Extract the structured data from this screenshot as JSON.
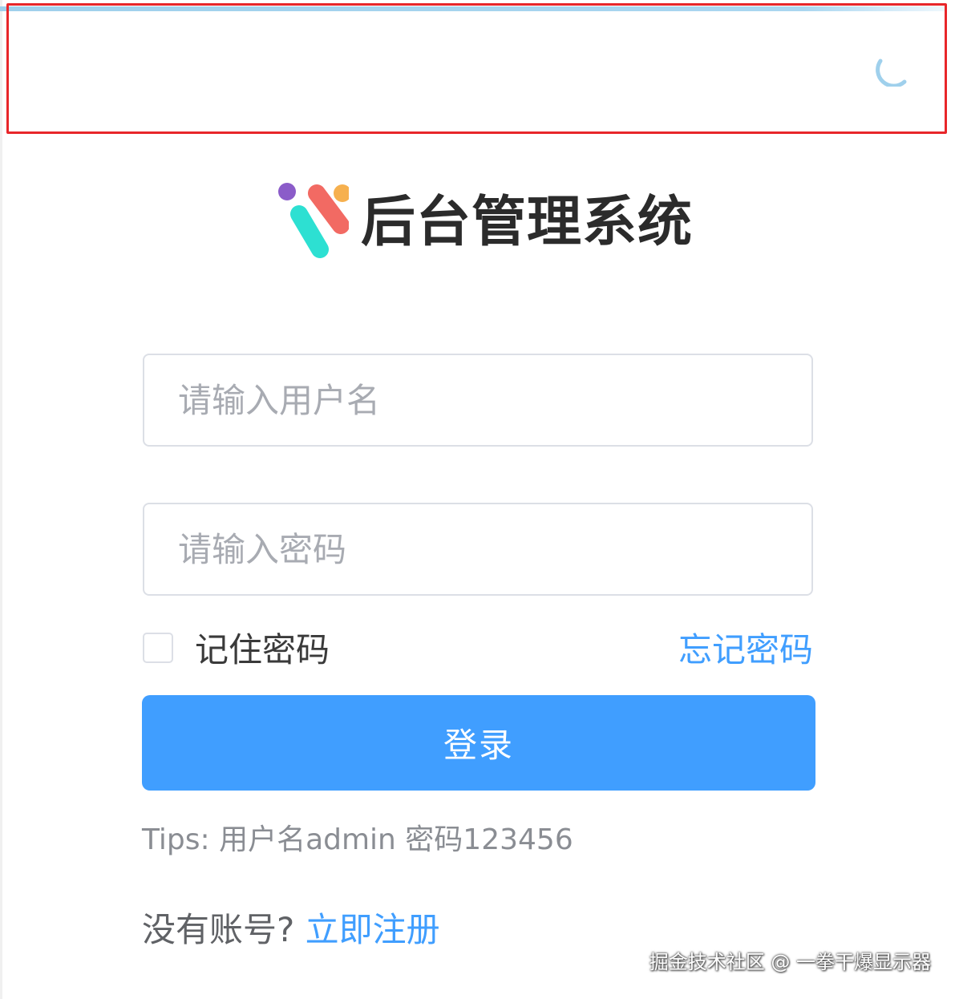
{
  "app": {
    "title": "后台管理系统"
  },
  "login_form": {
    "username_placeholder": "请输入用户名",
    "username_value": "",
    "password_placeholder": "请输入密码",
    "password_value": "",
    "remember_label": "记住密码",
    "remember_checked": false,
    "forgot_label": "忘记密码",
    "submit_label": "登录",
    "tips": "Tips: 用户名admin 密码123456",
    "no_account_label": "没有账号?",
    "register_label": "立即注册"
  },
  "loading": {
    "spinner_icon": "loading-spinner-icon",
    "progress_color": "#a9d6f0"
  },
  "watermark": {
    "text": "掘金技术社区 @ 一拳干爆显示器"
  },
  "colors": {
    "primary": "#409eff",
    "highlight": "#e8262a",
    "title": "#2b2b2b"
  }
}
